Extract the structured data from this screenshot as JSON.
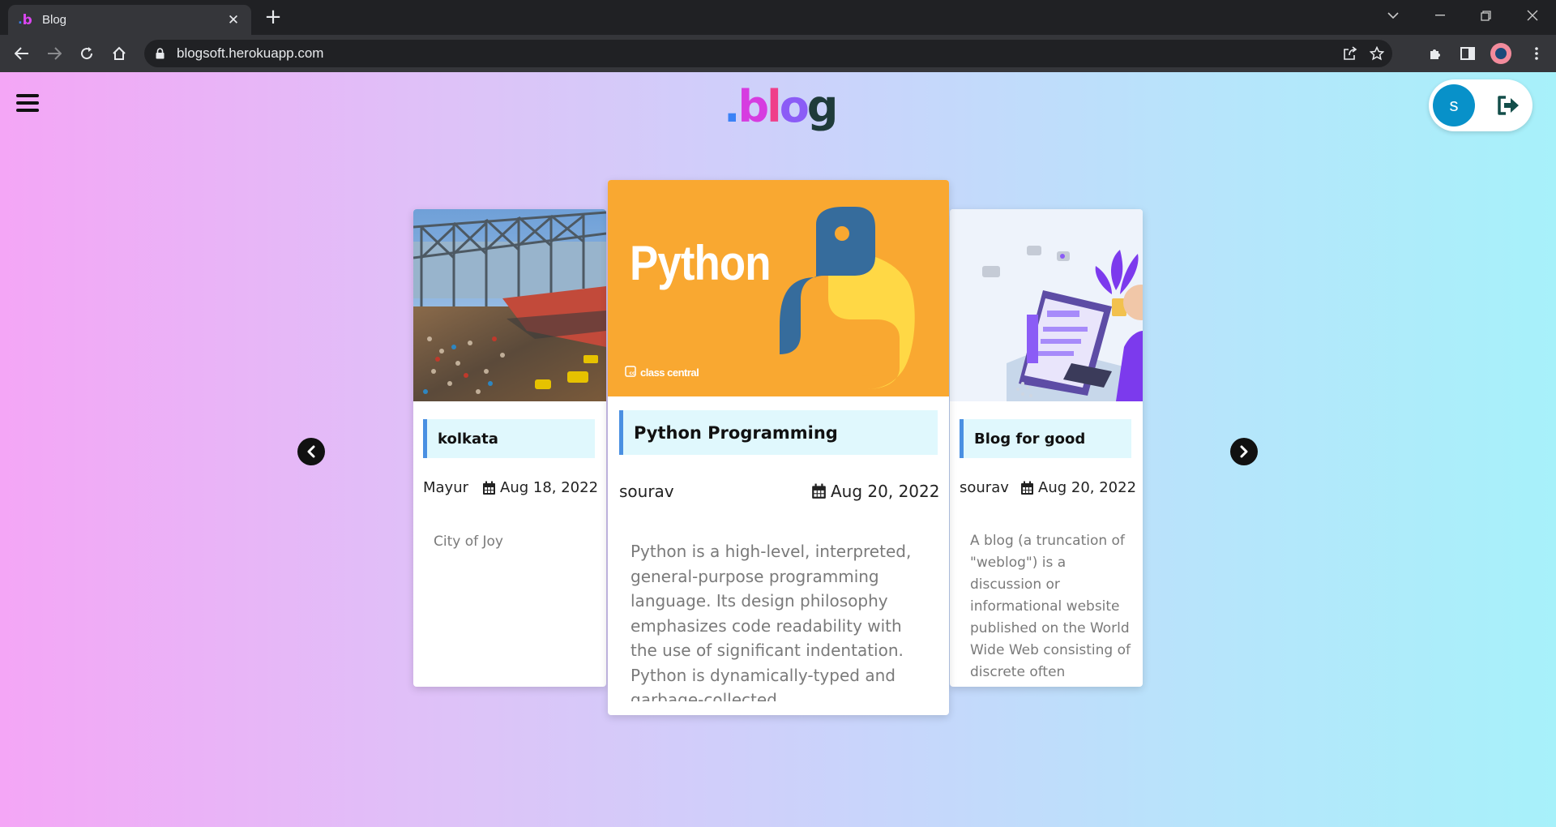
{
  "browser": {
    "tab_title": "Blog",
    "url": "blogsoft.herokuapp.com"
  },
  "header": {
    "logo": {
      "dot": ".",
      "letters": [
        "b",
        "l",
        "o",
        "g"
      ]
    },
    "user_initial": "s"
  },
  "carousel": {
    "cards": [
      {
        "title": "kolkata",
        "author": "Mayur",
        "date": "Aug 18, 2022",
        "description": "City of Joy"
      },
      {
        "title": "Python Programming",
        "author": "sourav",
        "date": "Aug 20, 2022",
        "description": "Python is a high-level, interpreted, general-purpose programming language. Its design philosophy emphasizes code readability with the use of significant indentation. Python is dynamically-typed and garbage-collected.",
        "image_title": "Python",
        "image_caption": "class central"
      },
      {
        "title": "Blog for good",
        "author": "sourav",
        "date": "Aug 20, 2022",
        "description": "A blog (a truncation of \"weblog\") is a discussion or informational website published on the World Wide Web consisting of discrete often"
      }
    ]
  },
  "colors": {
    "gradient_left": "#f4a6f6",
    "gradient_right": "#a7f1fa",
    "title_bar_accent": "#4a90e2",
    "avatar_bg": "#0891c9",
    "python_orange": "#f9a831"
  }
}
